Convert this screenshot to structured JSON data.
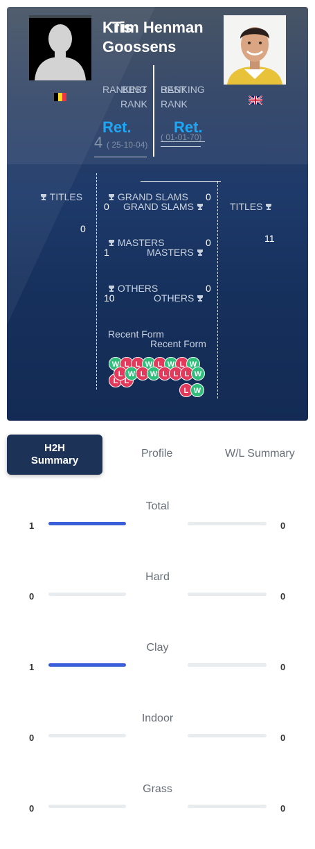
{
  "player_left": {
    "name": "Kris Goossens",
    "name_line1": "Kris",
    "name_line2": "Goossens",
    "flag_colors": [
      "#000000",
      "#fdda24",
      "#ef3340"
    ],
    "ranking_label_line1": "RANKING",
    "ranking_label_line2": "RANK",
    "best_label_overlap": "BEST",
    "ranking_value": "Ret.",
    "best_rank": "4",
    "best_date": "( 25-10-04)",
    "titles_label": "TITLES",
    "titles": "0",
    "grand_slams": "0",
    "masters": "1",
    "others": "10"
  },
  "player_right": {
    "name": "Tim Henman",
    "ranking_label_line1": "RANKING",
    "ranking_label_line2": "RANK",
    "best_label_overlap": "BEST",
    "ranking_value": "Ret.",
    "best_date": "( 01-01-70)",
    "titles_label": "TITLES",
    "titles": "11",
    "grand_slams": "0",
    "masters": "0",
    "others": "0"
  },
  "center": {
    "grand_slams_label": "GRAND SLAMS",
    "masters_label": "MASTERS",
    "others_label": "OTHERS",
    "recent_form_label": "Recent Form"
  },
  "recent_form_left": {
    "row1": [
      "W",
      "L",
      "L",
      "W",
      "L",
      "W",
      "L",
      "W"
    ],
    "row2": [
      "L",
      "L"
    ]
  },
  "recent_form_right": {
    "row1": [
      "L",
      "W",
      "L",
      "W",
      "L",
      "L",
      "L",
      "W"
    ],
    "row2": [
      "L",
      "W"
    ]
  },
  "tabs": {
    "h2h_line1": "H2H",
    "h2h_line2": "Summary",
    "profile": "Profile",
    "wl_summary": "W/L Summary"
  },
  "surfaces": [
    {
      "label": "Total",
      "left": 1,
      "right": 0,
      "left_fraction": 1.0,
      "right_fraction": 0.0
    },
    {
      "label": "Hard",
      "left": 0,
      "right": 0,
      "left_fraction": 0.0,
      "right_fraction": 0.0
    },
    {
      "label": "Clay",
      "left": 1,
      "right": 0,
      "left_fraction": 1.0,
      "right_fraction": 0.0
    },
    {
      "label": "Indoor",
      "left": 0,
      "right": 0,
      "left_fraction": 0.0,
      "right_fraction": 0.0
    },
    {
      "label": "Grass",
      "left": 0,
      "right": 0,
      "left_fraction": 0.0,
      "right_fraction": 0.0
    }
  ],
  "colors": {
    "accent_blue": "#1ea7f5",
    "bar_fill": "#3a5fd8",
    "win_chip": "#2fbf7a",
    "loss_chip": "#e3395a",
    "header_navy": "#1d3257"
  },
  "icons": {
    "trophy": "trophy-icon",
    "silhouette": "player-silhouette-icon",
    "flag_left": "belgium-flag-icon",
    "flag_right": "uk-flag-icon"
  }
}
